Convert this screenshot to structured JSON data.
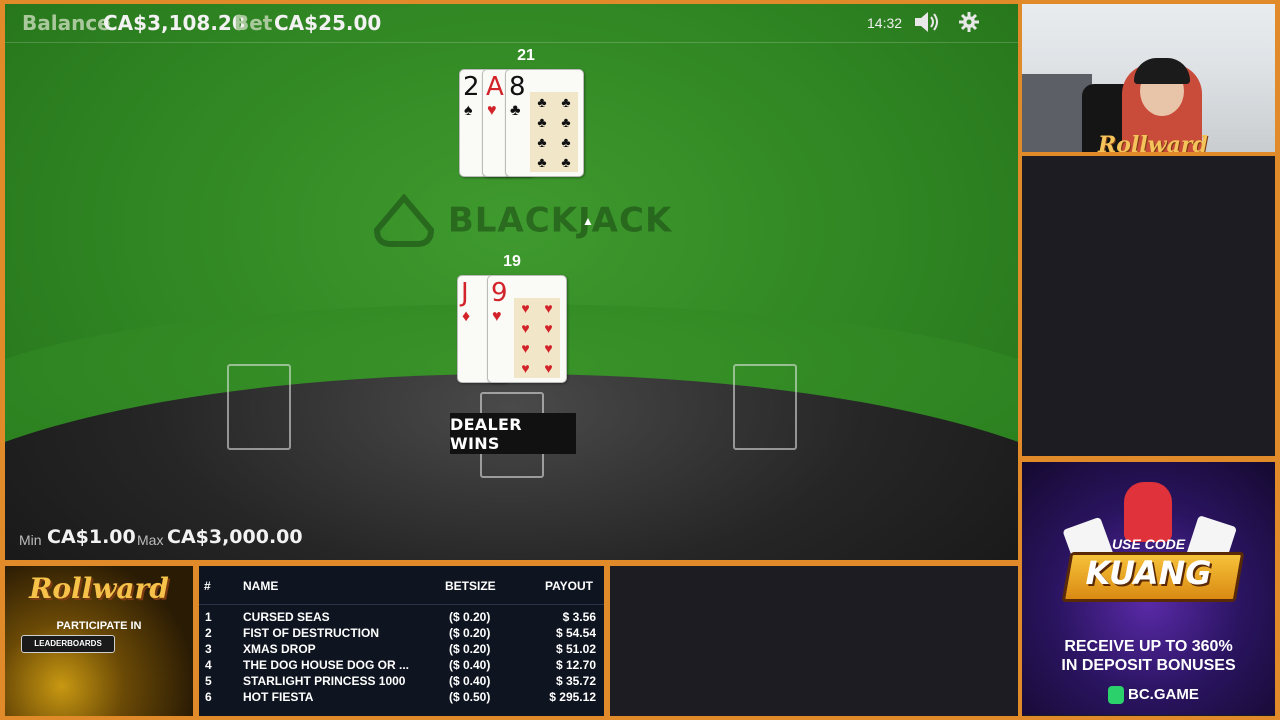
{
  "game": {
    "balance_label": "Balance",
    "balance": "CA$3,108.20",
    "bet_label": "Bet",
    "bet": "CA$25.00",
    "time": "14:32",
    "logo_text": "BLACKJACK",
    "result": "DEALER WINS",
    "min_label": "Min",
    "min_value": "CA$1.00",
    "max_label": "Max",
    "max_value": "CA$3,000.00",
    "dealer": {
      "total": "21",
      "cards": [
        {
          "rank": "2",
          "suit": "♠"
        },
        {
          "rank": "A",
          "suit": "♥"
        },
        {
          "rank": "8",
          "suit": "♣"
        }
      ]
    },
    "player": {
      "total": "19",
      "cards": [
        {
          "rank": "J",
          "suit": "♦"
        },
        {
          "rank": "9",
          "suit": "♥"
        }
      ]
    },
    "icons": {
      "sound": "speaker-icon",
      "settings": "gear-icon"
    }
  },
  "webcam": {
    "brand": "Rollward"
  },
  "promo": {
    "brand": "Rollward",
    "line1": "PARTICIPATE IN",
    "line2": "LEADERBOARDS"
  },
  "leaderboard": {
    "headers": {
      "rank": "#",
      "name": "NAME",
      "betsize": "BETSIZE",
      "payout": "PAYOUT"
    },
    "rows": [
      {
        "rank": "1",
        "name": "CURSED SEAS",
        "betsize": "($ 0.20)",
        "payout": "$ 3.56"
      },
      {
        "rank": "2",
        "name": "FIST OF DESTRUCTION",
        "betsize": "($ 0.20)",
        "payout": "$ 54.54"
      },
      {
        "rank": "3",
        "name": "XMAS DROP",
        "betsize": "($ 0.20)",
        "payout": "$ 51.02"
      },
      {
        "rank": "4",
        "name": "THE DOG HOUSE DOG OR ...",
        "betsize": "($ 0.40)",
        "payout": "$ 12.70"
      },
      {
        "rank": "5",
        "name": "STARLIGHT PRINCESS 1000",
        "betsize": "($ 0.40)",
        "payout": "$ 35.72"
      },
      {
        "rank": "6",
        "name": "HOT FIESTA",
        "betsize": "($ 0.50)",
        "payout": "$ 295.12"
      }
    ]
  },
  "ad": {
    "code_label": "USE CODE",
    "code": "KUANG",
    "line1": "RECEIVE UP TO 360%",
    "line2": "IN DEPOSIT BONUSES",
    "brand": "BC.GAME",
    "colors": {
      "accent": "#f2b31c",
      "bg": "#2a1460"
    }
  }
}
